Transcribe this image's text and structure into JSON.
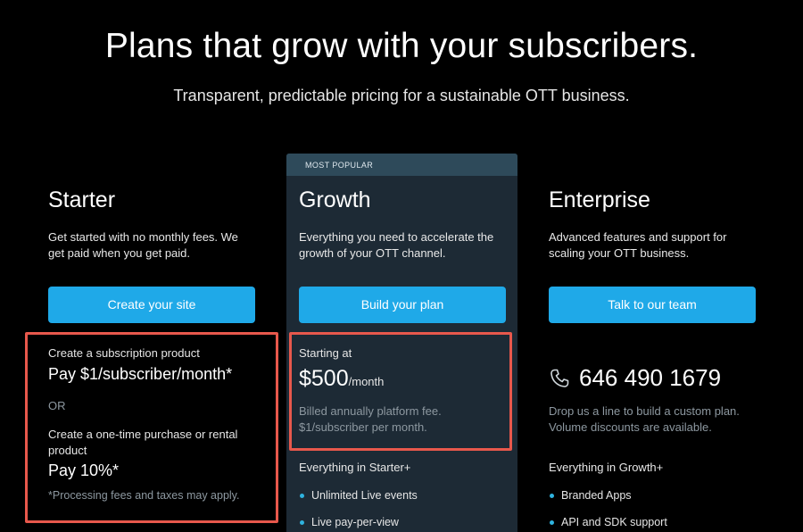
{
  "hero": {
    "title": "Plans that grow with your subscribers.",
    "subtitle": "Transparent, predictable pricing for a sustainable OTT business."
  },
  "plans": {
    "starter": {
      "name": "Starter",
      "description": "Get started with no monthly fees. We get paid when you get paid.",
      "cta": "Create your site",
      "subscription_label": "Create a subscription product",
      "subscription_price": "Pay $1/subscriber/month*",
      "or": "OR",
      "onetime_label": "Create a one-time purchase or rental product",
      "onetime_price": "Pay 10%*",
      "footnote": "*Processing fees and taxes may apply."
    },
    "growth": {
      "badge": "MOST POPULAR",
      "name": "Growth",
      "description": "Everything you need to accelerate the growth of your OTT channel.",
      "cta": "Build your plan",
      "starting_label": "Starting at",
      "price": "$500",
      "price_period": "/month",
      "billing_note": "Billed annually platform fee. $1/subscriber per month.",
      "features_heading": "Everything in Starter+",
      "features": [
        "Unlimited Live events",
        "Live pay-per-view"
      ]
    },
    "enterprise": {
      "name": "Enterprise",
      "description": "Advanced features and support for scaling your OTT business.",
      "cta": "Talk to our team",
      "phone": "646 490 1679",
      "phone_icon": "phone-icon",
      "contact_note": "Drop us a line to build a custom plan. Volume discounts are available.",
      "features_heading": "Everything in Growth+",
      "features": [
        "Branded Apps",
        "API and SDK support"
      ]
    }
  },
  "colors": {
    "background": "#000000",
    "card": "#1d2a35",
    "cta": "#1fa9e8",
    "highlight": "#e8584c",
    "bullet": "#2fb3df"
  }
}
